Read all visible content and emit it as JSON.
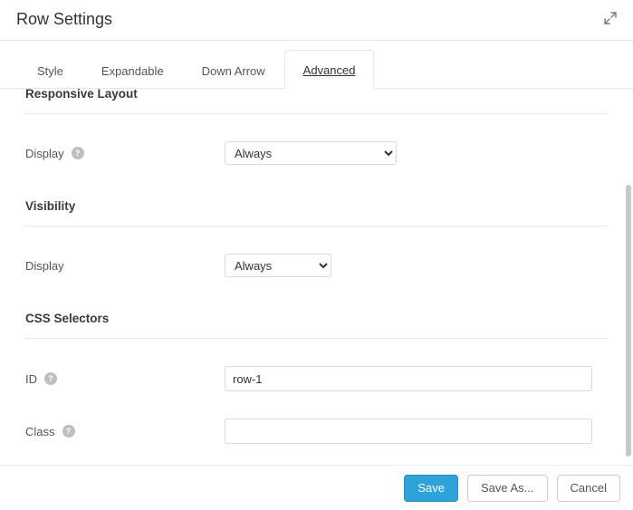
{
  "header": {
    "title": "Row Settings"
  },
  "tabs": [
    {
      "label": "Style"
    },
    {
      "label": "Expandable"
    },
    {
      "label": "Down Arrow"
    },
    {
      "label": "Advanced"
    }
  ],
  "sections": {
    "responsive": {
      "title": "Responsive Layout",
      "display_label": "Display",
      "display_value": "Always"
    },
    "visibility": {
      "title": "Visibility",
      "display_label": "Display",
      "display_value": "Always"
    },
    "css": {
      "title": "CSS Selectors",
      "id_label": "ID",
      "id_value": "row-1",
      "class_label": "Class",
      "class_value": ""
    }
  },
  "footer": {
    "save": "Save",
    "save_as": "Save As...",
    "cancel": "Cancel"
  }
}
